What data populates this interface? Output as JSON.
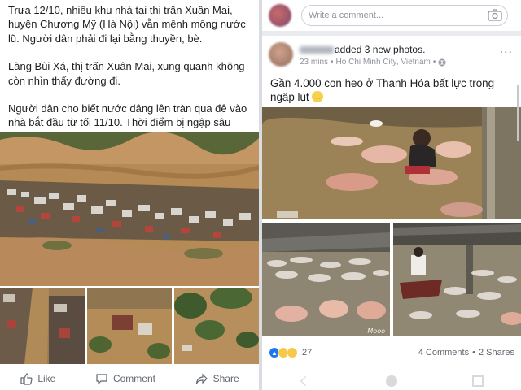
{
  "left_post": {
    "paragraphs": [
      "Trưa 12/10, nhiều khu nhà tại thị trấn Xuân Mai, huyện Chương Mỹ (Hà Nội) vẫn mênh mông nước lũ. Người dân phải đi lại bằng thuyền, bè.",
      "Làng Bùi Xá, thị trấn Xuân Mai, xung quanh không còn nhìn thấy đường đi.",
      "Người dân cho biết nước dâng lên tràn qua đê vào nhà bắt đầu từ tối 11/10. Thời điểm bị ngập sâu nhất nước dâng tới tận ngực người lớn. (theo Zing)"
    ],
    "actions": {
      "like": "Like",
      "comment": "Comment",
      "share": "Share"
    }
  },
  "right_post": {
    "composer_placeholder": "Write a comment...",
    "author_suffix": "added 3 new photos.",
    "time": "23 mins",
    "location": "Ho Chi Minh City, Vietnam",
    "more_label": "...",
    "caption": "Gần 4.000 con heo ở Thanh Hóa bất lực trong ngập lụt",
    "watermark": "Mooo",
    "reaction_count": "27",
    "comments": "4 Comments",
    "shares": "2 Shares",
    "separator": "•"
  },
  "colors": {
    "fb_blue": "#1877f2",
    "text": "#1c1e21",
    "muted": "#606770",
    "flood_water": "#b08a56"
  },
  "icons": [
    "like-icon",
    "comment-icon",
    "share-icon",
    "camera-icon",
    "globe-icon",
    "haha-emoji-icon",
    "sad-emoji-icon"
  ]
}
